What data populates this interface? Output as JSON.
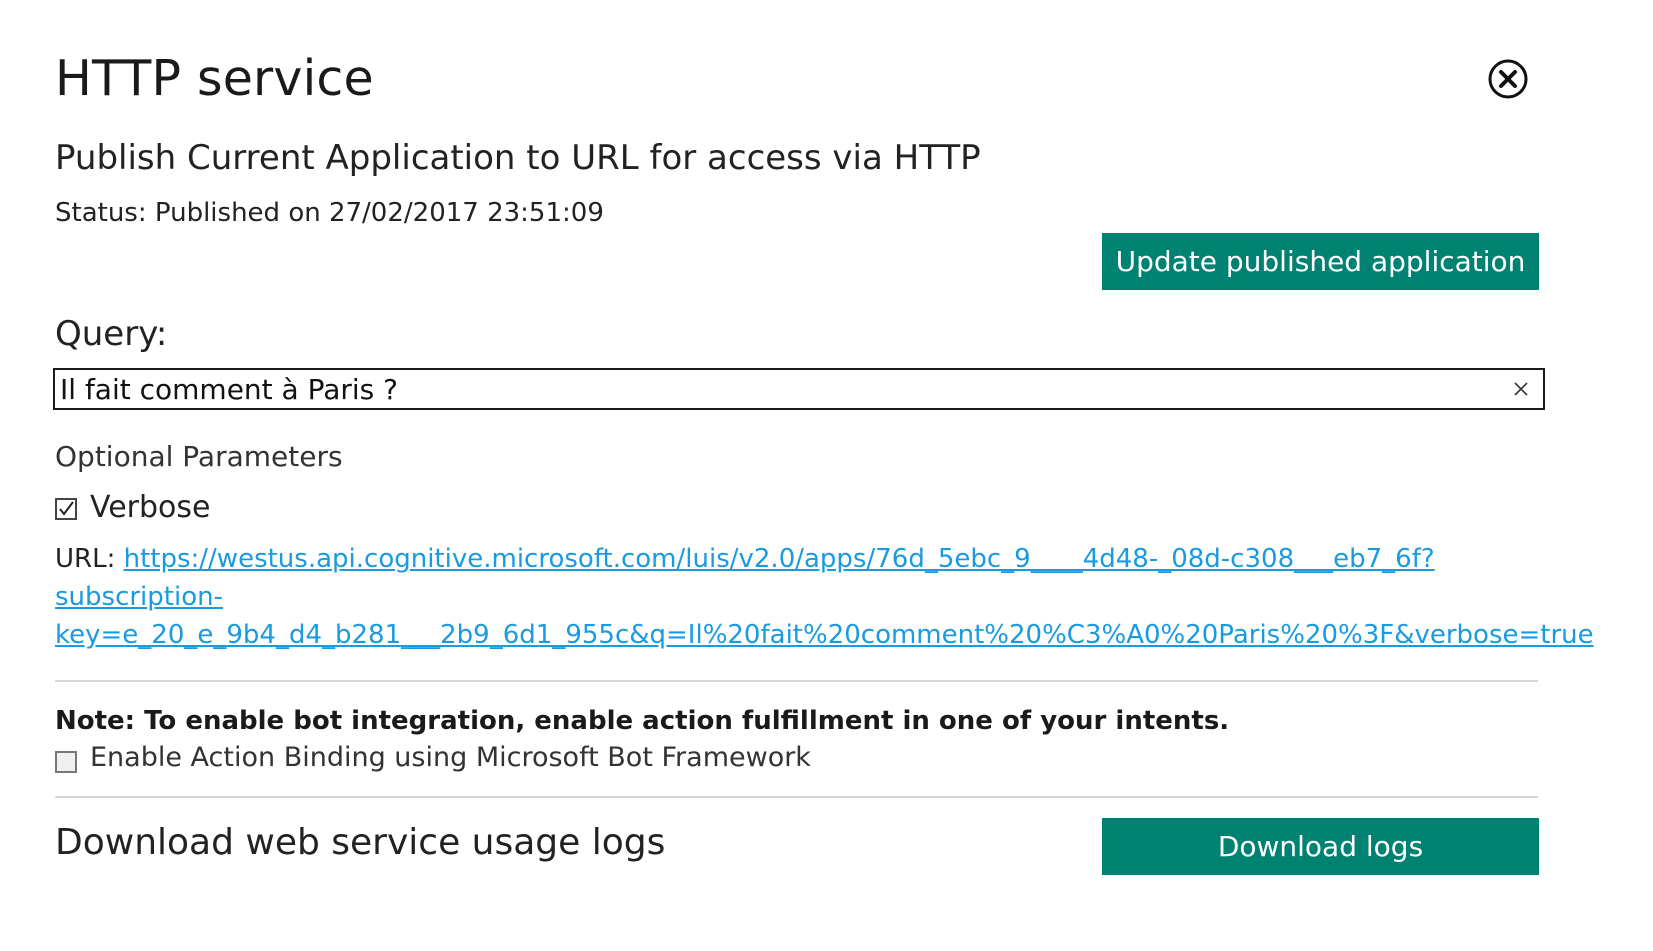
{
  "dialog": {
    "title": "HTTP service",
    "close_icon": "close-circle-icon",
    "subtitle": "Publish Current Application to URL for access via HTTP",
    "status": "Status: Published on 27/02/2017 23:51:09",
    "update_button_label": "Update published application"
  },
  "query": {
    "label": "Query:",
    "value": "Il fait comment à Paris ?",
    "clear_icon": "clear-x-icon"
  },
  "optional_params": {
    "label": "Optional Parameters",
    "verbose_label": "Verbose",
    "verbose_checked": true
  },
  "url": {
    "prefix": "URL: ",
    "link_line1": "https://westus.api.cognitive.microsoft.com/luis/v2.0/apps/76d_5ebc_9____4d48-_08d-c308___eb7_6f?",
    "link_line2": "subscription-",
    "link_line3": "key=e_20_e_9b4_d4_b281___2b9_6d1_955c&q=Il%20fait%20comment%20%C3%A0%20Paris%20%3F&verbose=true"
  },
  "bot": {
    "note": "Note: To enable bot integration, enable action fulfillment in one of your intents.",
    "binding_label": "Enable Action Binding using Microsoft Bot Framework",
    "binding_checked": false
  },
  "logs": {
    "label": "Download web service usage logs",
    "button_label": "Download logs"
  },
  "colors": {
    "accent": "#008272",
    "link": "#1a9ae0",
    "divider": "#d8d8d8"
  }
}
